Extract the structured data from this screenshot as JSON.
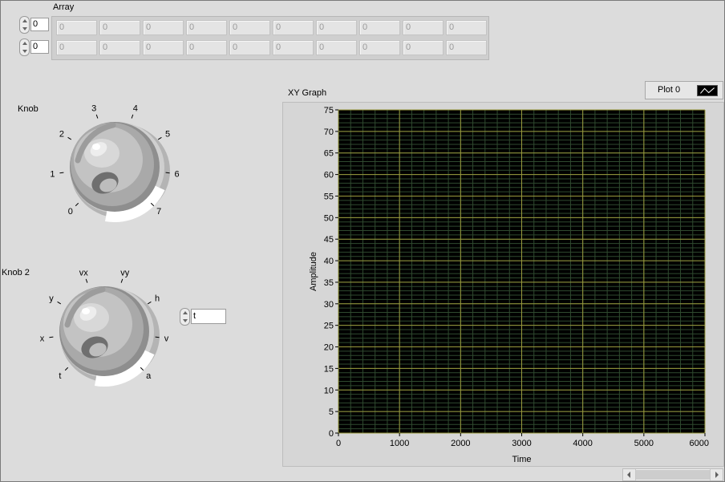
{
  "array": {
    "label": "Array",
    "indices": [
      "0",
      "0"
    ],
    "rows": [
      [
        "0",
        "0",
        "0",
        "0",
        "0",
        "0",
        "0",
        "0",
        "0",
        "0"
      ],
      [
        "0",
        "0",
        "0",
        "0",
        "0",
        "0",
        "0",
        "0",
        "0",
        "0"
      ]
    ]
  },
  "knob1": {
    "label": "Knob",
    "scale": [
      "0",
      "1",
      "2",
      "3",
      "4",
      "5",
      "6",
      "7"
    ]
  },
  "knob2": {
    "label": "Knob 2",
    "scale": [
      "t",
      "x",
      "y",
      "vx",
      "vy",
      "h",
      "v",
      "a"
    ],
    "value": "t"
  },
  "xy_graph": {
    "label": "XY Graph",
    "legend": {
      "plot_name": "Plot 0"
    }
  },
  "chart_data": {
    "type": "scatter",
    "title": "XY Graph",
    "xlabel": "Time",
    "ylabel": "Amplitude",
    "xlim": [
      0,
      6000
    ],
    "ylim": [
      0,
      75
    ],
    "x_ticks": [
      0,
      1000,
      2000,
      3000,
      4000,
      5000,
      6000
    ],
    "y_ticks": [
      0,
      5,
      10,
      15,
      20,
      25,
      30,
      35,
      40,
      45,
      50,
      55,
      60,
      65,
      70,
      75
    ],
    "grid": true,
    "legend": "top-right",
    "series": [
      {
        "name": "Plot 0",
        "x": [],
        "y": []
      }
    ],
    "colors": {
      "plot_background": "#000000",
      "major_grid": "#9a9a3c",
      "minor_grid": "#2f4a2f"
    }
  }
}
